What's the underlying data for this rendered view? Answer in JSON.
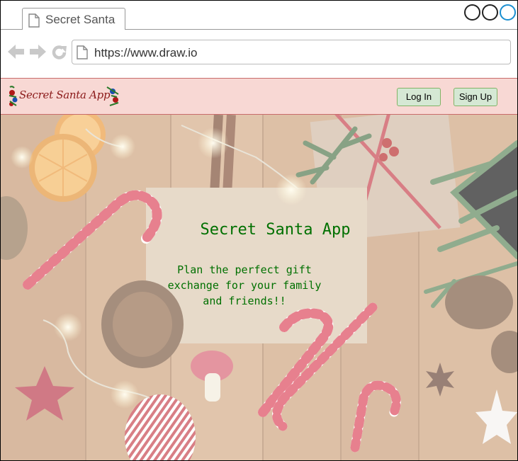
{
  "browser": {
    "tab_title": "Secret Santa",
    "url": "https://www.draw.io"
  },
  "header": {
    "logo_text": "Secret Santa App",
    "login_label": "Log In",
    "signup_label": "Sign Up"
  },
  "hero": {
    "title": "Secret Santa App",
    "subtitle": "Plan the perfect gift exchange for your family and friends!!"
  },
  "colors": {
    "header_bg": "#f8d8d4",
    "button_bg": "#d5e8d4",
    "hero_text": "#007000"
  }
}
